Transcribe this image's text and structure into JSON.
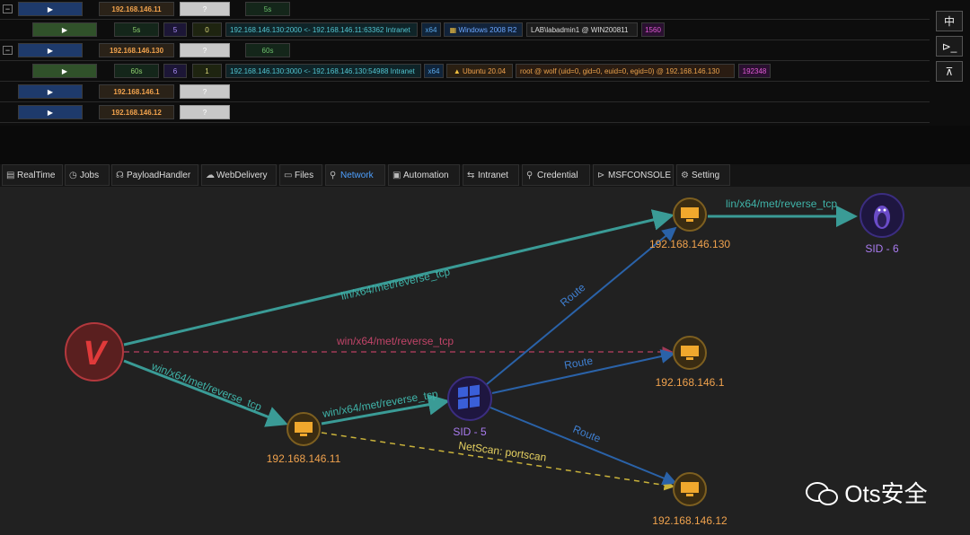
{
  "sessions": [
    {
      "toggle": "−",
      "ip": "192.168.146.11",
      "status": "?",
      "interval": "5s"
    },
    {
      "sleep": "5s",
      "id": "5",
      "count": "0",
      "connection": "192.168.146.130:2000 <- 192.168.146.11:63362 Intranet",
      "arch": "x64",
      "os": "Windows 2008 R2",
      "user": "LAB\\labadmin1 @ WIN200811",
      "pid": "1560"
    },
    {
      "toggle": "−",
      "ip": "192.168.146.130",
      "status": "?",
      "interval": "60s"
    },
    {
      "sleep": "60s",
      "id": "6",
      "count": "1",
      "connection": "192.168.146.130:3000 <- 192.168.146.130:54988 Intranet",
      "arch": "x64",
      "os": "Ubuntu 20.04",
      "user": "root @ wolf (uid=0, gid=0, euid=0, egid=0) @ 192.168.146.130",
      "pid": "192348"
    },
    {
      "ip": "192.168.146.1",
      "status": "?"
    },
    {
      "ip": "192.168.146.12",
      "status": "?"
    }
  ],
  "side_buttons": [
    "中",
    "⊳_",
    "⊼"
  ],
  "tabs": [
    {
      "label": "RealTime",
      "icon": "▤"
    },
    {
      "label": "Jobs",
      "icon": "◷"
    },
    {
      "label": "PayloadHandler",
      "icon": "☊"
    },
    {
      "label": "WebDelivery",
      "icon": "☁"
    },
    {
      "label": "Files",
      "icon": "▭"
    },
    {
      "label": "Network",
      "icon": "⚲"
    },
    {
      "label": "Automation",
      "icon": "▣"
    },
    {
      "label": "Intranet",
      "icon": "⇆"
    },
    {
      "label": "Credential",
      "icon": "⚲"
    },
    {
      "label": "MSFCONSOLE",
      "icon": "⊳"
    },
    {
      "label": "Setting",
      "icon": "⚙"
    }
  ],
  "active_tab": "Network",
  "graph": {
    "nodes": {
      "origin": "V",
      "h11": "192.168.146.11",
      "sid5": "SID - 5",
      "h130": "192.168.146.130",
      "sid6": "SID - 6",
      "h1": "192.168.146.1",
      "h12": "192.168.146.12"
    },
    "edges": {
      "lin_main": "lin/x64/met/reverse_tcp",
      "lin_top": "lin/x64/met/reverse_tcp",
      "win_dashed": "win/x64/met/reverse_tcp",
      "win_main": "win/x64/met/reverse_tcp",
      "win_to_sid5": "win/x64/met/reverse_tcp",
      "route_130": "Route",
      "route_1": "Route",
      "route_12": "Route",
      "netscan": "NetScan: portscan"
    }
  },
  "watermark": "Ots安全",
  "colors": {
    "accent": "#4ea0ff",
    "teal": "#3a9b96",
    "route": "#2a62a8",
    "dashed_red": "#a13a57",
    "dashed_yellow": "#c9b23a"
  }
}
